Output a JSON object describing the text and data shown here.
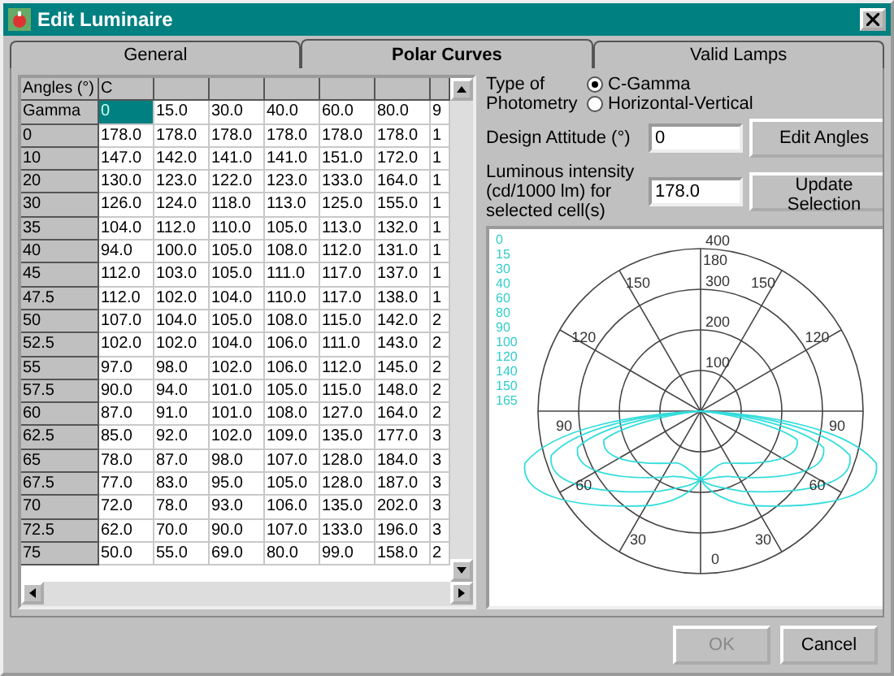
{
  "window": {
    "title": "Edit Luminaire"
  },
  "tabs": [
    {
      "label": "General",
      "selected": false
    },
    {
      "label": "Polar Curves",
      "selected": true
    },
    {
      "label": "Valid Lamps",
      "selected": false
    }
  ],
  "table": {
    "corner": "Angles (°)",
    "c_label": "C",
    "gamma_label": "Gamma",
    "columns": [
      {
        "label": "0",
        "selected": true
      },
      {
        "label": "15.0",
        "selected": false
      },
      {
        "label": "30.0",
        "selected": false
      },
      {
        "label": "40.0",
        "selected": false
      },
      {
        "label": "60.0",
        "selected": false
      },
      {
        "label": "80.0",
        "selected": false
      },
      {
        "label": "9",
        "selected": false
      }
    ],
    "rows": [
      {
        "label": "0",
        "cells": [
          "178.0",
          "178.0",
          "178.0",
          "178.0",
          "178.0",
          "178.0",
          "1"
        ]
      },
      {
        "label": "10",
        "cells": [
          "147.0",
          "142.0",
          "141.0",
          "141.0",
          "151.0",
          "172.0",
          "1"
        ]
      },
      {
        "label": "20",
        "cells": [
          "130.0",
          "123.0",
          "122.0",
          "123.0",
          "133.0",
          "164.0",
          "1"
        ]
      },
      {
        "label": "30",
        "cells": [
          "126.0",
          "124.0",
          "118.0",
          "113.0",
          "125.0",
          "155.0",
          "1"
        ]
      },
      {
        "label": "35",
        "cells": [
          "104.0",
          "112.0",
          "110.0",
          "105.0",
          "113.0",
          "132.0",
          "1"
        ]
      },
      {
        "label": "40",
        "cells": [
          "94.0",
          "100.0",
          "105.0",
          "108.0",
          "112.0",
          "131.0",
          "1"
        ]
      },
      {
        "label": "45",
        "cells": [
          "112.0",
          "103.0",
          "105.0",
          "111.0",
          "117.0",
          "137.0",
          "1"
        ]
      },
      {
        "label": "47.5",
        "cells": [
          "112.0",
          "102.0",
          "104.0",
          "110.0",
          "117.0",
          "138.0",
          "1"
        ]
      },
      {
        "label": "50",
        "cells": [
          "107.0",
          "104.0",
          "105.0",
          "108.0",
          "115.0",
          "142.0",
          "2"
        ]
      },
      {
        "label": "52.5",
        "cells": [
          "102.0",
          "102.0",
          "104.0",
          "106.0",
          "111.0",
          "143.0",
          "2"
        ]
      },
      {
        "label": "55",
        "cells": [
          "97.0",
          "98.0",
          "102.0",
          "106.0",
          "112.0",
          "145.0",
          "2"
        ]
      },
      {
        "label": "57.5",
        "cells": [
          "90.0",
          "94.0",
          "101.0",
          "105.0",
          "115.0",
          "148.0",
          "2"
        ]
      },
      {
        "label": "60",
        "cells": [
          "87.0",
          "91.0",
          "101.0",
          "108.0",
          "127.0",
          "164.0",
          "2"
        ]
      },
      {
        "label": "62.5",
        "cells": [
          "85.0",
          "92.0",
          "102.0",
          "109.0",
          "135.0",
          "177.0",
          "3"
        ]
      },
      {
        "label": "65",
        "cells": [
          "78.0",
          "87.0",
          "98.0",
          "107.0",
          "128.0",
          "184.0",
          "3"
        ]
      },
      {
        "label": "67.5",
        "cells": [
          "77.0",
          "83.0",
          "95.0",
          "105.0",
          "128.0",
          "187.0",
          "3"
        ]
      },
      {
        "label": "70",
        "cells": [
          "72.0",
          "78.0",
          "93.0",
          "106.0",
          "135.0",
          "202.0",
          "3"
        ]
      },
      {
        "label": "72.5",
        "cells": [
          "62.0",
          "70.0",
          "90.0",
          "107.0",
          "133.0",
          "196.0",
          "3"
        ]
      },
      {
        "label": "75",
        "cells": [
          "50.0",
          "55.0",
          "69.0",
          "80.0",
          "99.0",
          "158.0",
          "2"
        ]
      }
    ]
  },
  "photometry": {
    "label": "Type of Photometry",
    "options": [
      {
        "label": "C-Gamma",
        "selected": true
      },
      {
        "label": "Horizontal-Vertical",
        "selected": false
      }
    ]
  },
  "design_attitude": {
    "label": "Design Attitude (°)",
    "value": "0",
    "button": "Edit Angles"
  },
  "intensity": {
    "label": "Luminous intensity (cd/1000 lm) for selected cell(s)",
    "value": "178.0",
    "button": "Update Selection"
  },
  "polar": {
    "legend": [
      "0",
      "15",
      "30",
      "40",
      "60",
      "80",
      "90",
      "100",
      "120",
      "140",
      "150",
      "165"
    ],
    "rings": [
      "400",
      "300",
      "200",
      "100"
    ],
    "angles": [
      "180",
      "150",
      "150",
      "120",
      "120",
      "90",
      "90",
      "60",
      "60",
      "30",
      "30",
      "0"
    ]
  },
  "buttons": [
    {
      "label": "OK",
      "disabled": true
    },
    {
      "label": "Cancel",
      "disabled": false
    }
  ]
}
